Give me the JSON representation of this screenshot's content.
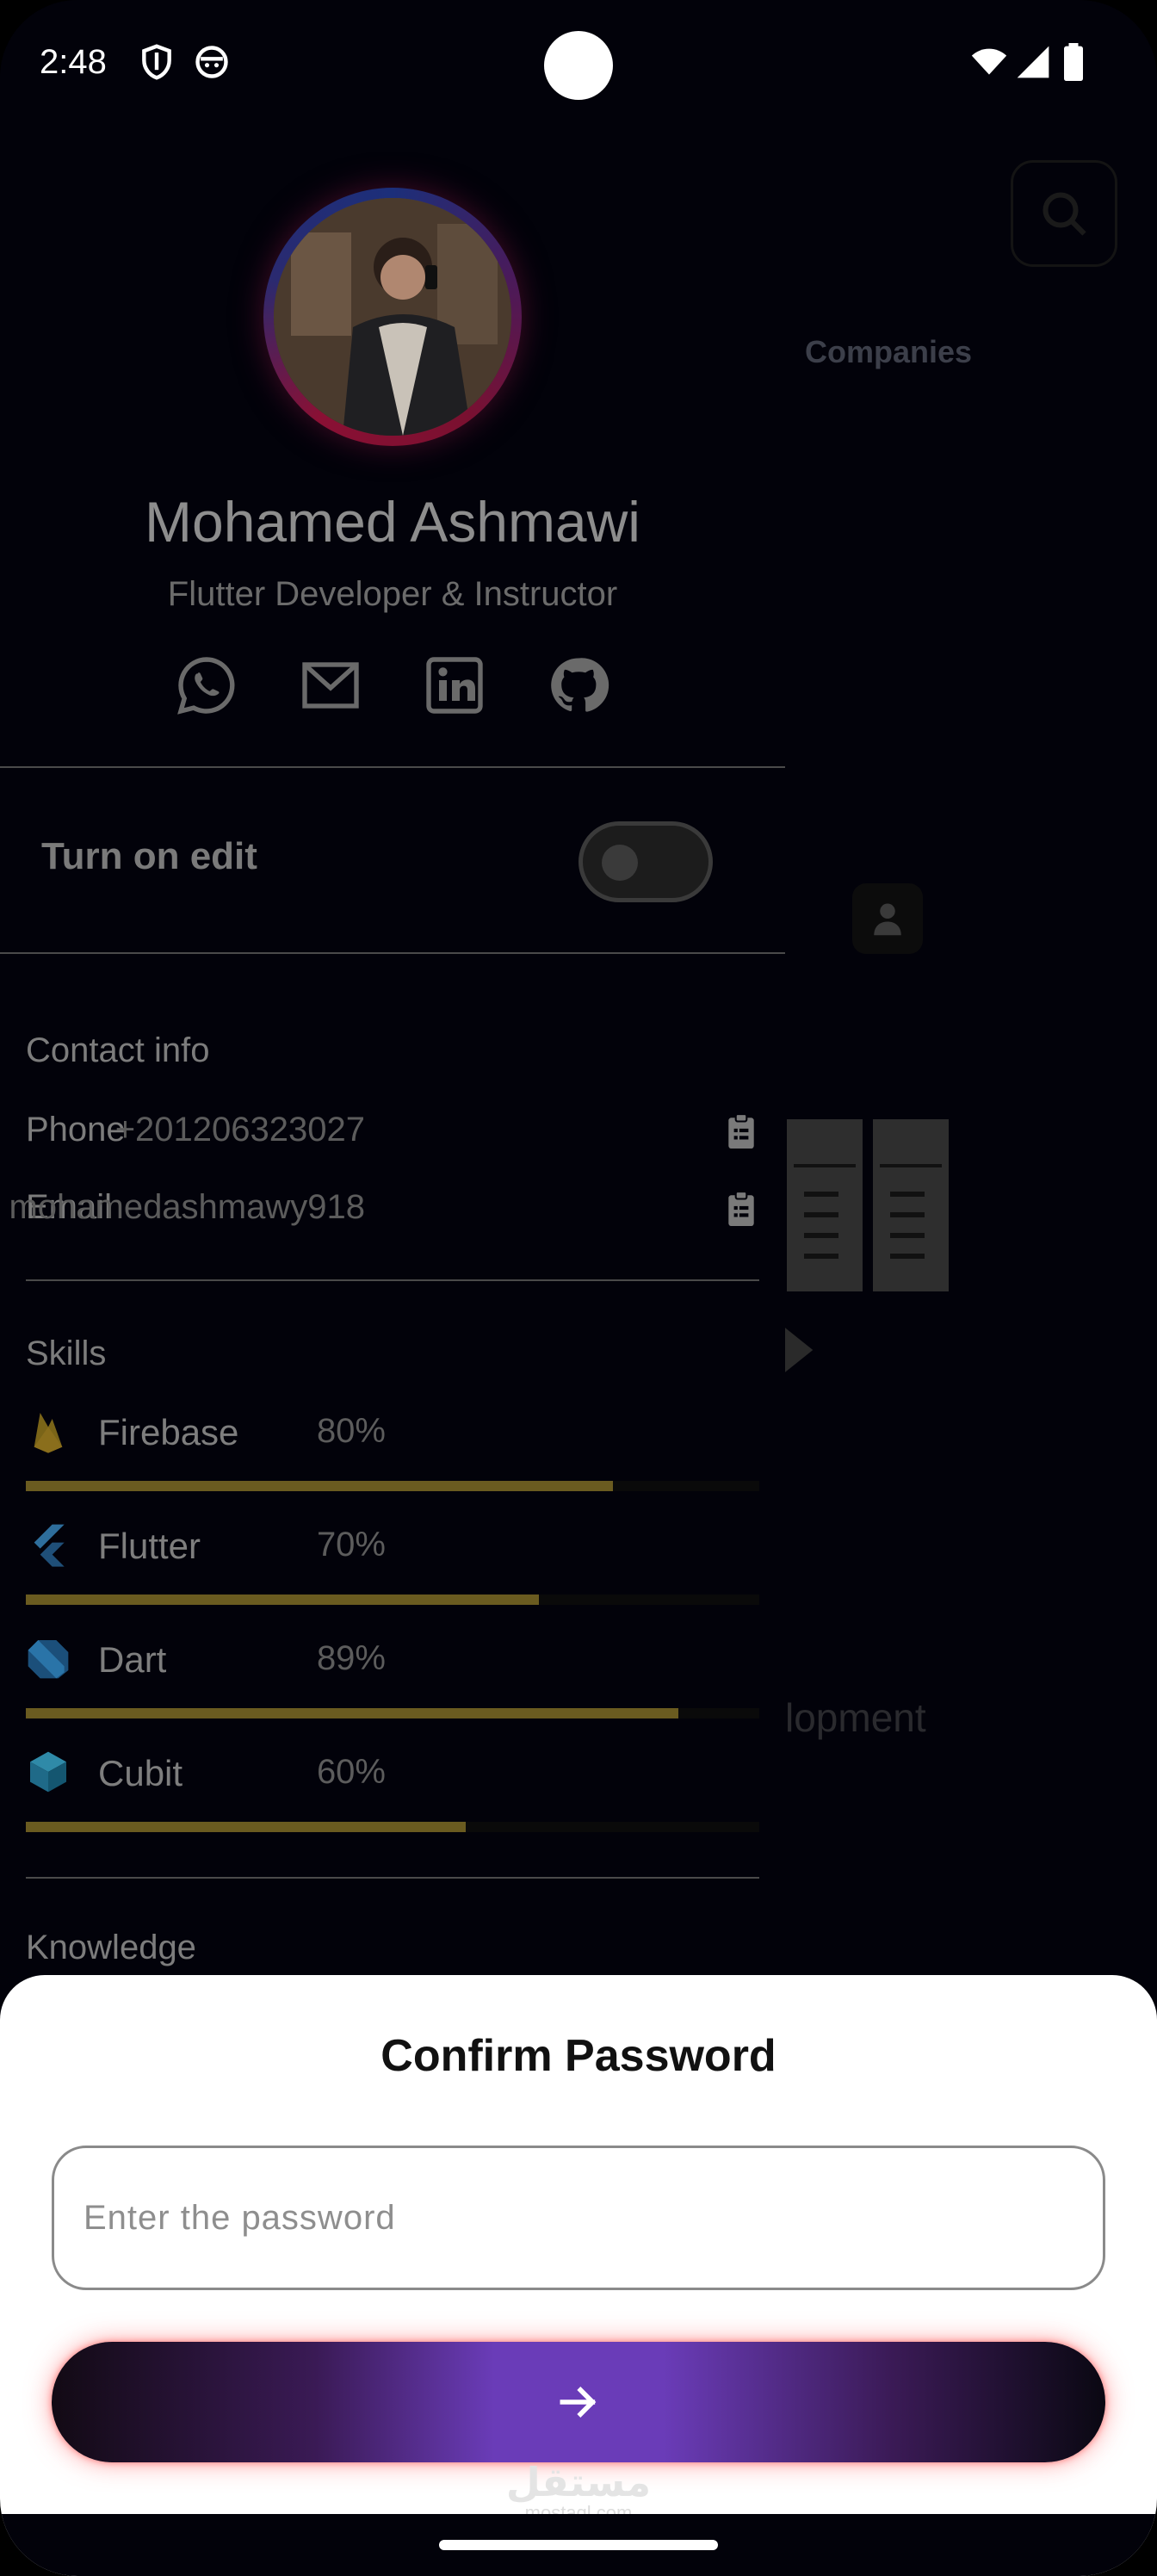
{
  "status_bar": {
    "time": "2:48",
    "icons": [
      "shield-icon",
      "face-icon",
      "wifi-icon",
      "signal-icon",
      "battery-icon"
    ]
  },
  "background_page": {
    "companies_label": "Companies",
    "development_label": "lopment"
  },
  "drawer": {
    "name": "Mohamed Ashmawi",
    "role": "Flutter Developer & Instructor",
    "socials": [
      "whatsapp-icon",
      "mail-icon",
      "linkedin-icon",
      "github-icon"
    ],
    "edit_toggle_label": "Turn on edit",
    "edit_toggle_on": false,
    "contact": {
      "title": "Contact info",
      "phone_label": "Phone",
      "phone_value": "+201206323027",
      "email_label": "Email",
      "email_value": "mohamedashmawy918"
    },
    "skills": {
      "title": "Skills",
      "items": [
        {
          "name": "Firebase",
          "percent": "80%",
          "level": 0.8,
          "icon": "firebase-icon"
        },
        {
          "name": "Flutter",
          "percent": "70%",
          "level": 0.7,
          "icon": "flutter-icon"
        },
        {
          "name": "Dart",
          "percent": "89%",
          "level": 0.89,
          "icon": "dart-icon"
        },
        {
          "name": "Cubit",
          "percent": "60%",
          "level": 0.6,
          "icon": "cubit-icon"
        }
      ]
    },
    "knowledge_title": "Knowledge"
  },
  "sheet": {
    "title": "Confirm Password",
    "password_placeholder": "Enter the password",
    "password_value": "",
    "submit_icon": "arrow-right-icon",
    "watermark": "مستقل",
    "watermark_sub": "mostaql.com"
  },
  "colors": {
    "accent_purple": "#6a3cb8",
    "skill_bar": "#6a5b20",
    "glow": "#ff5050"
  }
}
